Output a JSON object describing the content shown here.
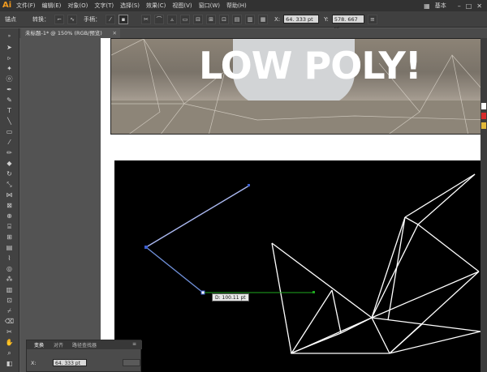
{
  "app": {
    "logo": "Ai",
    "menus": [
      "文件(F)",
      "编辑(E)",
      "对象(O)",
      "文字(T)",
      "选择(S)",
      "效果(C)",
      "视图(V)",
      "窗口(W)",
      "帮助(H)"
    ],
    "workspace_label": "基本"
  },
  "control_bar": {
    "anchor_label": "锚点",
    "convert_label": "转换：",
    "handle_label": "手柄：",
    "x_value": "64. 333  pt",
    "y_value": "578. 667  pt"
  },
  "document_tab": {
    "title": "未标题-1* @ 150% (RGB/预览)"
  },
  "artwork": {
    "headline": "LOW POLY!",
    "measure_tooltip": "D: 100.11 pt"
  },
  "transform_panel": {
    "tabs": [
      "变换",
      "对齐",
      "路径查找器"
    ],
    "x_label": "X:",
    "x_value": "64. 333  pt"
  },
  "colors": {
    "menubar_bg": "#323232",
    "accent": "#f29b1f",
    "pen_path": "#6f8fd8",
    "guide_line": "#1ea81e",
    "poly_lines": "#ffffff",
    "artboard_black": "#000000"
  }
}
